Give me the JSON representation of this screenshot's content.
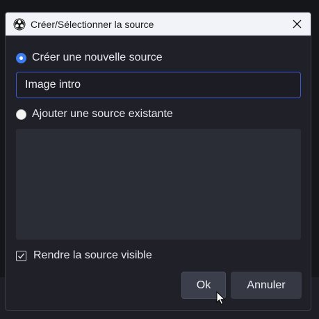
{
  "window": {
    "title": "Créer/Sélectionner la source"
  },
  "options": {
    "create_new": {
      "label": "Créer une nouvelle source",
      "selected": true
    },
    "existing": {
      "label": "Ajouter une source existante",
      "selected": false
    }
  },
  "name_input": {
    "value": "Image intro"
  },
  "existing_sources": [],
  "visible_checkbox": {
    "label": "Rendre la source visible",
    "checked": true
  },
  "buttons": {
    "ok": "Ok",
    "cancel": "Annuler"
  },
  "colors": {
    "accent": "#3d7df0",
    "dialog_bg": "#1f2028",
    "titlebar_bg": "#f1f3f8"
  }
}
